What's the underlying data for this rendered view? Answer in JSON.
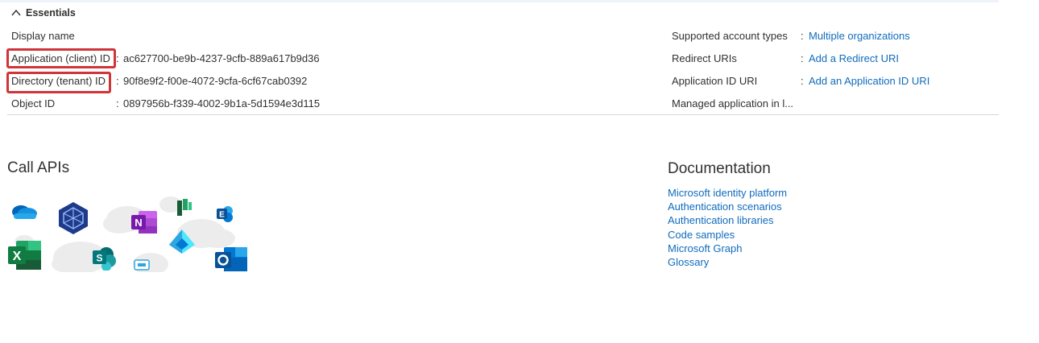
{
  "essentials": {
    "title": "Essentials",
    "left": [
      {
        "label": "Display name",
        "value": ""
      },
      {
        "label": "Application (client) ID",
        "value": "ac627700-be9b-4237-9cfb-889a617b9d36"
      },
      {
        "label": "Directory (tenant) ID",
        "value": "90f8e9f2-f00e-4072-9cfa-6cf67cab0392"
      },
      {
        "label": "Object ID",
        "value": "0897956b-f339-4002-9b1a-5d1594e3d115"
      }
    ],
    "right": [
      {
        "label": "Supported account types",
        "value": "Multiple organizations"
      },
      {
        "label": "Redirect URIs",
        "value": "Add a Redirect URI"
      },
      {
        "label": "Application ID URI",
        "value": "Add an Application ID URI"
      },
      {
        "label": "Managed application in l...",
        "value": ""
      }
    ],
    "separator": ":"
  },
  "call_apis": {
    "title": "Call APIs",
    "icons": [
      "onedrive-icon",
      "azure-devops-icon",
      "onenote-icon",
      "planner-icon",
      "exchange-icon",
      "excel-icon",
      "sharepoint-icon",
      "azure-ad-icon",
      "skype-icon",
      "outlook-icon"
    ]
  },
  "documentation": {
    "title": "Documentation",
    "links": [
      "Microsoft identity platform",
      "Authentication scenarios",
      "Authentication libraries",
      "Code samples",
      "Microsoft Graph",
      "Glossary"
    ]
  },
  "colors": {
    "link": "#0f6cbd",
    "highlight": "#d13438",
    "text": "#323130"
  }
}
